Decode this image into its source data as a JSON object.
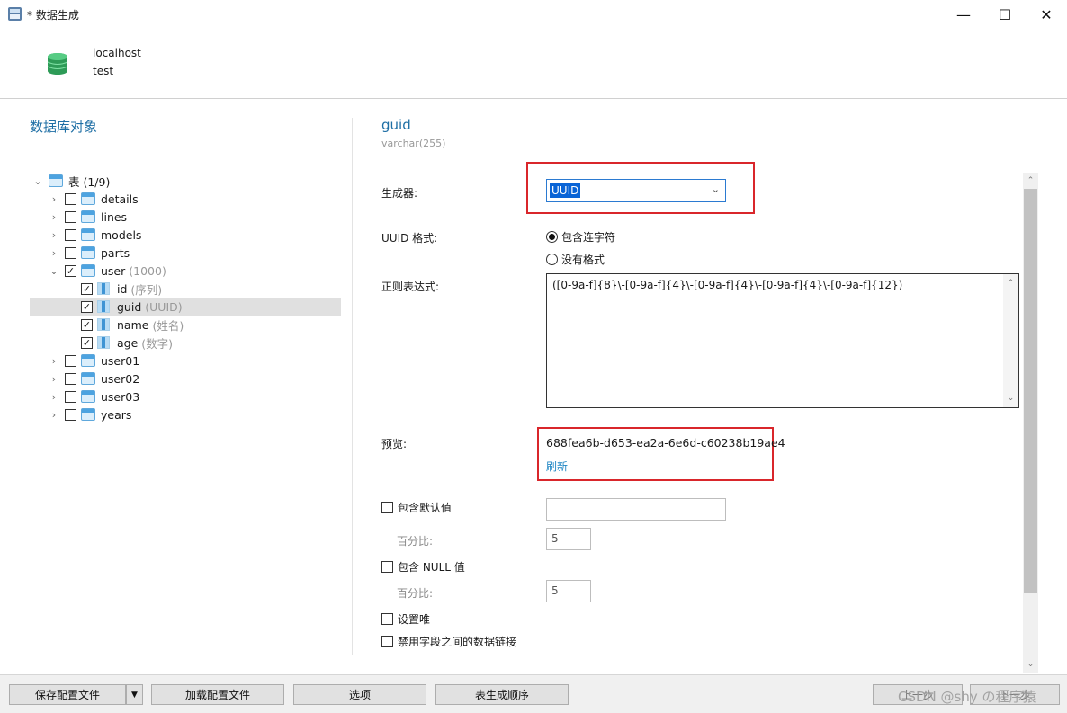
{
  "window": {
    "title": "* 数据生成",
    "app_icon": "navicat-icon",
    "controls": [
      "minimize-icon",
      "maximize-icon",
      "close-icon"
    ]
  },
  "connection": {
    "icon": "database-icon",
    "host": "localhost",
    "database": "test"
  },
  "left_panel": {
    "title": "数据库对象",
    "tree_root": {
      "label": "表 (1/9)"
    },
    "tables": [
      {
        "name": "details",
        "checked": false,
        "expanded": false
      },
      {
        "name": "lines",
        "checked": false,
        "expanded": false
      },
      {
        "name": "models",
        "checked": false,
        "expanded": false
      },
      {
        "name": "parts",
        "checked": false,
        "expanded": false
      },
      {
        "name": "user",
        "count": "(1000)",
        "checked": true,
        "expanded": true
      },
      {
        "name": "user01",
        "checked": false,
        "expanded": false
      },
      {
        "name": "user02",
        "checked": false,
        "expanded": false
      },
      {
        "name": "user03",
        "checked": false,
        "expanded": false
      },
      {
        "name": "years",
        "checked": false,
        "expanded": false
      }
    ],
    "columns": [
      {
        "name": "id",
        "note": "(序列)",
        "checked": true
      },
      {
        "name": "guid",
        "note": "(UUID)",
        "checked": true,
        "selected": true
      },
      {
        "name": "name",
        "note": "(姓名)",
        "checked": true
      },
      {
        "name": "age",
        "note": "(数字)",
        "checked": true
      }
    ]
  },
  "right_panel": {
    "field_name": "guid",
    "field_type": "varchar(255)",
    "generator_label": "生成器:",
    "generator_value": "UUID",
    "uuid_format_label": "UUID 格式:",
    "uuid_format_options": [
      {
        "label": "包含连字符",
        "selected": true
      },
      {
        "label": "没有格式",
        "selected": false
      }
    ],
    "regex_label": "正则表达式:",
    "regex_value": "([0-9a-f]{8}\\-[0-9a-f]{4}\\-[0-9a-f]{4}\\-[0-9a-f]{4}\\-[0-9a-f]{12})",
    "preview_label": "预览:",
    "preview_value": "688fea6b-d653-ea2a-6e6d-c60238b19ae4",
    "refresh_label": "刷新",
    "include_default_label": "包含默认值",
    "include_default_value": "",
    "default_percent_label": "百分比:",
    "default_percent_value": "5",
    "include_null_label": "包含 NULL 值",
    "null_percent_label": "百分比:",
    "null_percent_value": "5",
    "unique_label": "设置唯一",
    "disable_link_label": "禁用字段之间的数据链接"
  },
  "bottom_bar": {
    "save_config": "保存配置文件",
    "load_config": "加载配置文件",
    "options": "选项",
    "table_order": "表生成顺序",
    "prev": "上一步",
    "next": "下一步"
  },
  "watermark": "CSDN @shy の程序猿",
  "colors": {
    "accent_blue": "#1f6fa5",
    "highlight_red": "#d9262b",
    "selection_blue": "#0a64d6",
    "link_blue": "#1f86c4"
  }
}
